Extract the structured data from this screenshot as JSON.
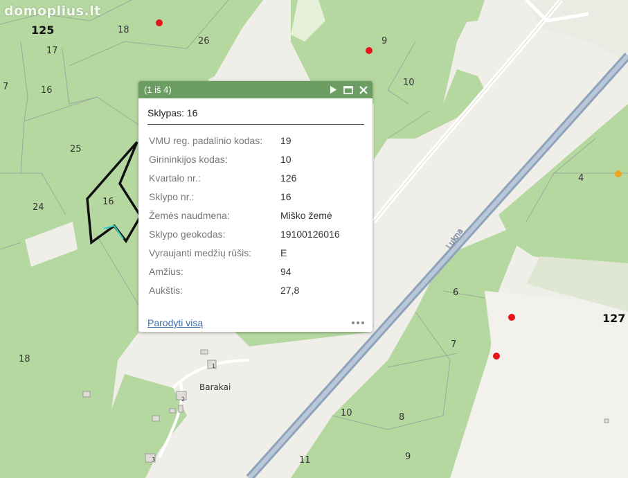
{
  "watermark": "domoplius.lt",
  "map": {
    "colors": {
      "forest": "#b5d8a0",
      "field": "#f0eee9",
      "road": "#9aaec2",
      "parcel_line": "#9aa99a",
      "marker_red": "#e8141b",
      "marker_orange": "#f0a41c"
    },
    "block_labels": [
      "125",
      "127"
    ],
    "parcel_labels": [
      "18",
      "26",
      "17",
      "7",
      "16",
      "25",
      "16",
      "24",
      "9",
      "10",
      "4",
      "6",
      "7",
      "18",
      "10",
      "8",
      "11",
      "9"
    ],
    "road_label": "Lukna",
    "place_label": "Barakai",
    "building_numbers": [
      "1",
      "2",
      "3"
    ]
  },
  "popup": {
    "counter": "(1 iš 4)",
    "title": "Sklypas: 16",
    "rows": [
      {
        "key": "VMU reg. padalinio kodas:",
        "value": "19"
      },
      {
        "key": "Girininkijos kodas:",
        "value": "10"
      },
      {
        "key": "Kvartalo nr.:",
        "value": "126"
      },
      {
        "key": "Sklypo nr.:",
        "value": "16"
      },
      {
        "key": "Žemės naudmena:",
        "value": "Miško žemė"
      },
      {
        "key": "Sklypo geokodas:",
        "value": "19100126016"
      },
      {
        "key": "Vyraujanti medžių rūšis:",
        "value": "E"
      },
      {
        "key": "Amžius:",
        "value": "94"
      },
      {
        "key": "Aukštis:",
        "value": "27,8"
      }
    ],
    "footer_link": "Parodyti visą",
    "icons": {
      "next": "play-icon",
      "maximize": "maximize-icon",
      "close": "close-icon",
      "more": "more-dots-icon"
    }
  }
}
